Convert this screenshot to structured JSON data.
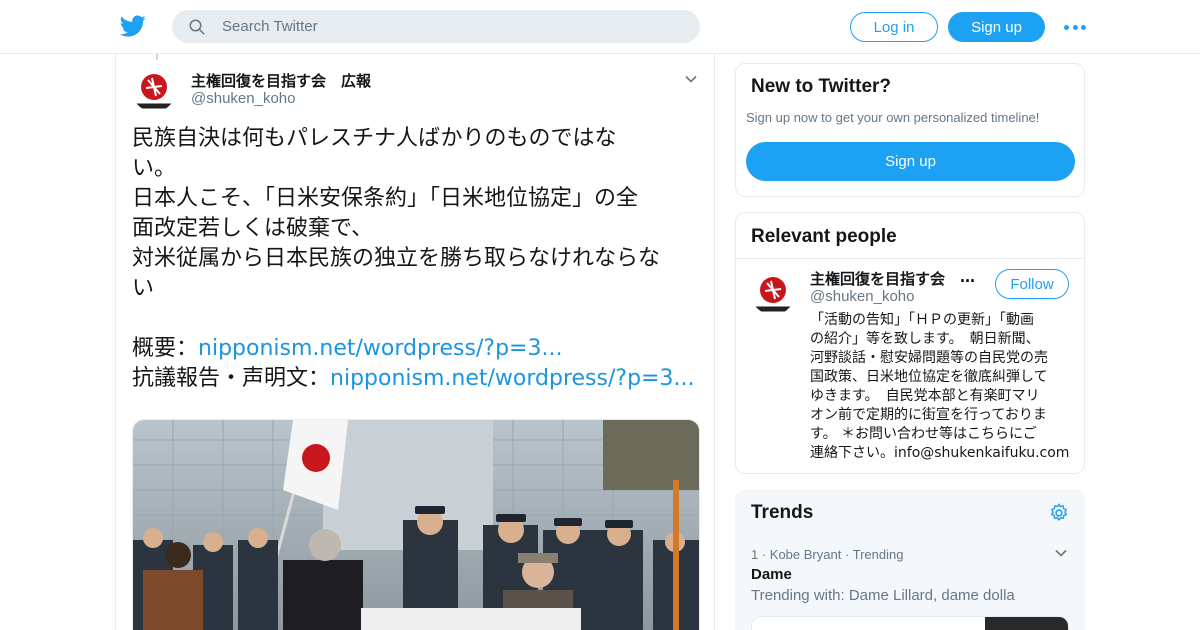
{
  "header": {
    "search_placeholder": "Search Twitter",
    "login_label": "Log in",
    "signup_label": "Sign up",
    "brand_color": "#1da1f2"
  },
  "tweet": {
    "author_name": "主権回復を目指す会　広報",
    "author_handle": "@shuken_koho",
    "lines": [
      "民族自決は何もパレスチナ人ばかりのものではな",
      "い。",
      "日本人こそ、「日米安保条約」「日米地位協定」の全",
      "面改定若しくは破棄で、",
      "対米従属から日本民族の独立を勝ち取らなけれならな",
      "い"
    ],
    "link1_prefix": "概要：",
    "link1_text": "nipponism.net/wordpress/?p=3...",
    "link2_prefix": "抗議報告・声明文：",
    "link2_text": "nipponism.net/wordpress/?p=3..."
  },
  "sidebar": {
    "new_to_twitter": {
      "title": "New to Twitter?",
      "text": "Sign up now to get your own personalized timeline!",
      "button": "Sign up"
    },
    "relevant_people": {
      "title": "Relevant people",
      "name": "主権回復を目指す会",
      "ellipsis": "…",
      "handle": "@shuken_koho",
      "follow_label": "Follow",
      "bio_lines": [
        "「活動の告知」「ＨＰの更新」「動画",
        "の紹介」等を致します。　朝日新聞、",
        "河野談話・慰安婦問題等の自民党の売",
        "国政策、日米地位協定を徹底糾弾して",
        "ゆきます。　自民党本部と有楽町マリ",
        "オン前で定期的に街宣を行っておりま",
        "す。 ＊お問い合わせ等はこちらにご",
        "連絡下さい。info@shukenkaifuku.com"
      ]
    },
    "trends": {
      "title": "Trends",
      "items": [
        {
          "meta": "1 · Kobe Bryant · Trending",
          "name": "Dame",
          "with": "Trending with: Dame Lillard, dame dolla"
        }
      ]
    }
  }
}
